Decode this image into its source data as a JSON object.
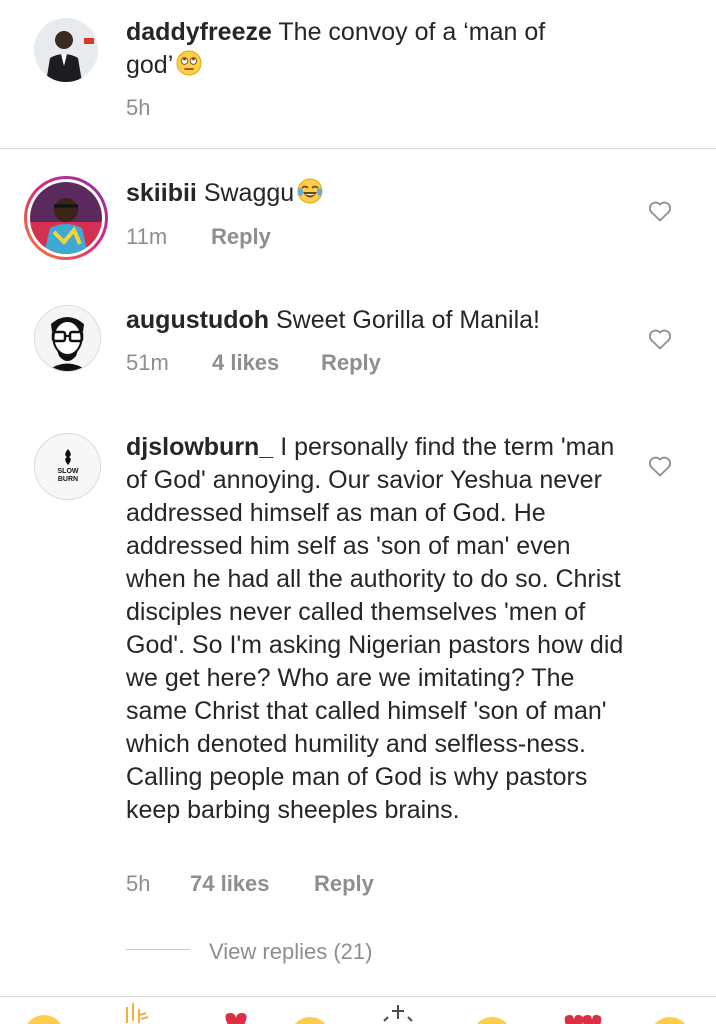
{
  "caption": {
    "username": "daddyfreeze",
    "text": "The convoy of a ‘man of god’",
    "emoji": "face-with-rolling-eyes",
    "time": "5h"
  },
  "comments": [
    {
      "username": "skiibii",
      "text": "Swaggu",
      "emoji": "face-with-tears-of-joy",
      "time": "11m",
      "likes": "",
      "reply_label": "Reply"
    },
    {
      "username": "augustudoh",
      "text": "Sweet Gorilla of Manila!",
      "time": "51m",
      "likes": "4 likes",
      "reply_label": "Reply"
    },
    {
      "username": "djslowburn_",
      "avatar_text": "SLOW BURN",
      "text": "I personally find the term 'man of  God' annoying. Our savior Yeshua never addressed himself as man of God. He addressed him self as 'son of man' even when he had all the authority to do so. Christ disciples never called themselves 'men of God'. So I'm asking Nigerian pastors how did we get here? Who are we imitating? The same Christ that called himself 'son of man' which denoted humility and selfless-ness. Calling people man of God is why pastors keep barbing sheeples brains.",
      "time": "5h",
      "likes": "74 likes",
      "reply_label": "Reply",
      "view_replies": "View replies (21)"
    }
  ],
  "colors": {
    "text": "#262626",
    "meta": "#8e8e8e",
    "divider": "#dbdbdb",
    "story_ring_start": "#f58529",
    "story_ring_end": "#dd2a7b",
    "emoji_yellow": "#ffcc4d"
  }
}
